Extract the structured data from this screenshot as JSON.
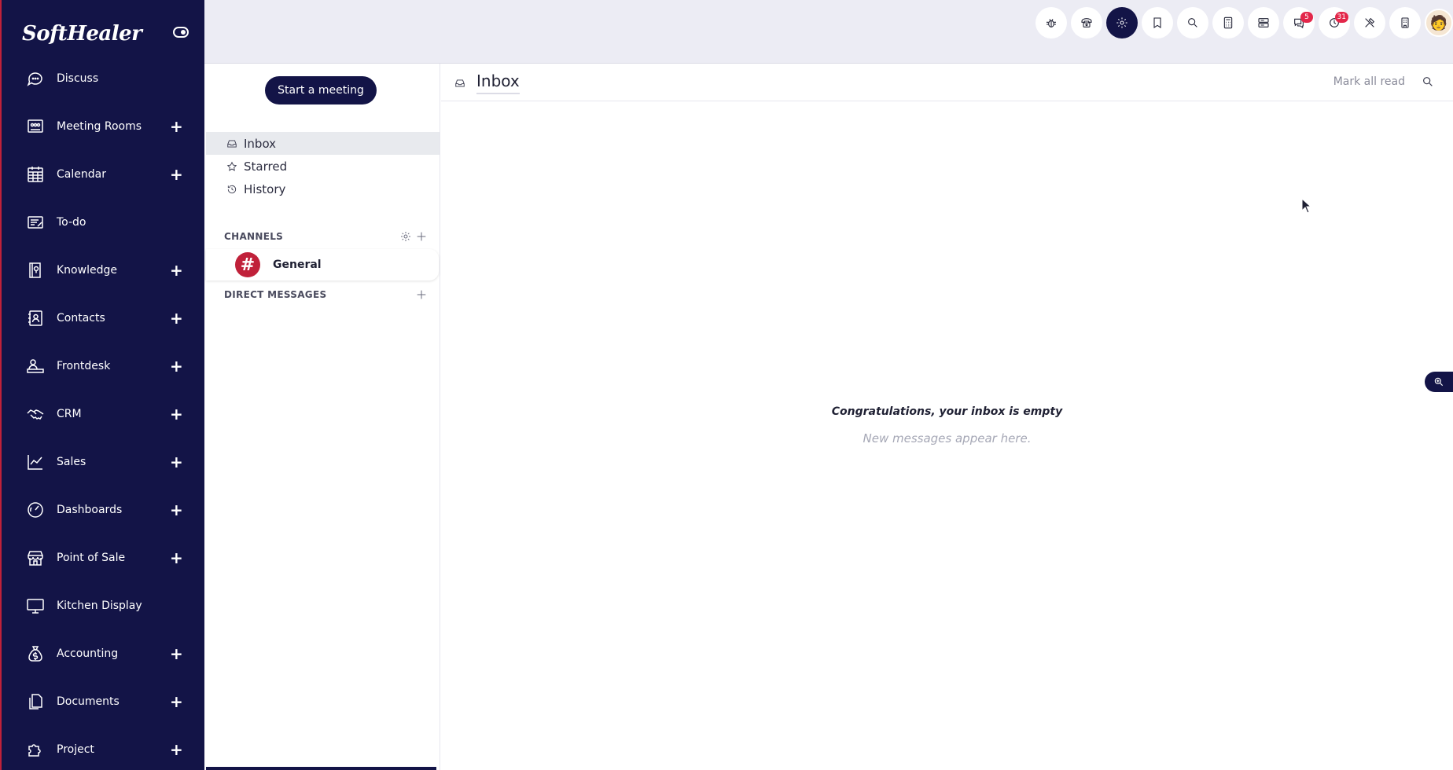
{
  "brand": {
    "name": "SoftHealer"
  },
  "sidebar": {
    "items": [
      {
        "label": "Discuss",
        "icon": "chat-bubble-icon",
        "plus": false
      },
      {
        "label": "Meeting Rooms",
        "icon": "meeting-room-icon",
        "plus": true
      },
      {
        "label": "Calendar",
        "icon": "calendar-icon",
        "plus": true
      },
      {
        "label": "To-do",
        "icon": "todo-icon",
        "plus": false
      },
      {
        "label": "Knowledge",
        "icon": "book-icon",
        "plus": true
      },
      {
        "label": "Contacts",
        "icon": "contact-card-icon",
        "plus": true
      },
      {
        "label": "Frontdesk",
        "icon": "frontdesk-icon",
        "plus": true
      },
      {
        "label": "CRM",
        "icon": "handshake-icon",
        "plus": true
      },
      {
        "label": "Sales",
        "icon": "trend-chart-icon",
        "plus": true
      },
      {
        "label": "Dashboards",
        "icon": "gauge-icon",
        "plus": true
      },
      {
        "label": "Point of Sale",
        "icon": "store-icon",
        "plus": true
      },
      {
        "label": "Kitchen Display",
        "icon": "monitor-icon",
        "plus": false
      },
      {
        "label": "Accounting",
        "icon": "money-bag-icon",
        "plus": true
      },
      {
        "label": "Documents",
        "icon": "documents-icon",
        "plus": true
      },
      {
        "label": "Project",
        "icon": "puzzle-icon",
        "plus": true
      }
    ],
    "plus_symbol": "+"
  },
  "topbar": {
    "icons": [
      {
        "name": "bug-icon"
      },
      {
        "name": "phone-icon"
      },
      {
        "name": "settings-icon",
        "active": true
      },
      {
        "name": "bookmark-icon"
      },
      {
        "name": "search-icon"
      },
      {
        "name": "calculator-icon"
      },
      {
        "name": "server-icon"
      },
      {
        "name": "messages-icon",
        "badge": "5"
      },
      {
        "name": "activity-clock-icon",
        "badge": "31"
      },
      {
        "name": "tools-icon"
      },
      {
        "name": "building-icon"
      }
    ],
    "avatar": "user-avatar"
  },
  "mail": {
    "start_meeting": "Start a meeting",
    "mailboxes": [
      {
        "label": "Inbox",
        "active": true
      },
      {
        "label": "Starred",
        "active": false
      },
      {
        "label": "History",
        "active": false
      }
    ],
    "channels_label": "CHANNELS",
    "channels": [
      {
        "name": "General",
        "symbol": "#"
      }
    ],
    "direct_messages_label": "DIRECT MESSAGES"
  },
  "content": {
    "title": "Inbox",
    "mark_all_read": "Mark all read",
    "empty_title": "Congratulations, your inbox is empty",
    "empty_subtitle": "New messages appear here."
  },
  "colors": {
    "sidebar_bg": "#131447",
    "accent_red": "#c0213a",
    "badge_red": "#e3274a",
    "topbar_bg": "#ececf4"
  }
}
